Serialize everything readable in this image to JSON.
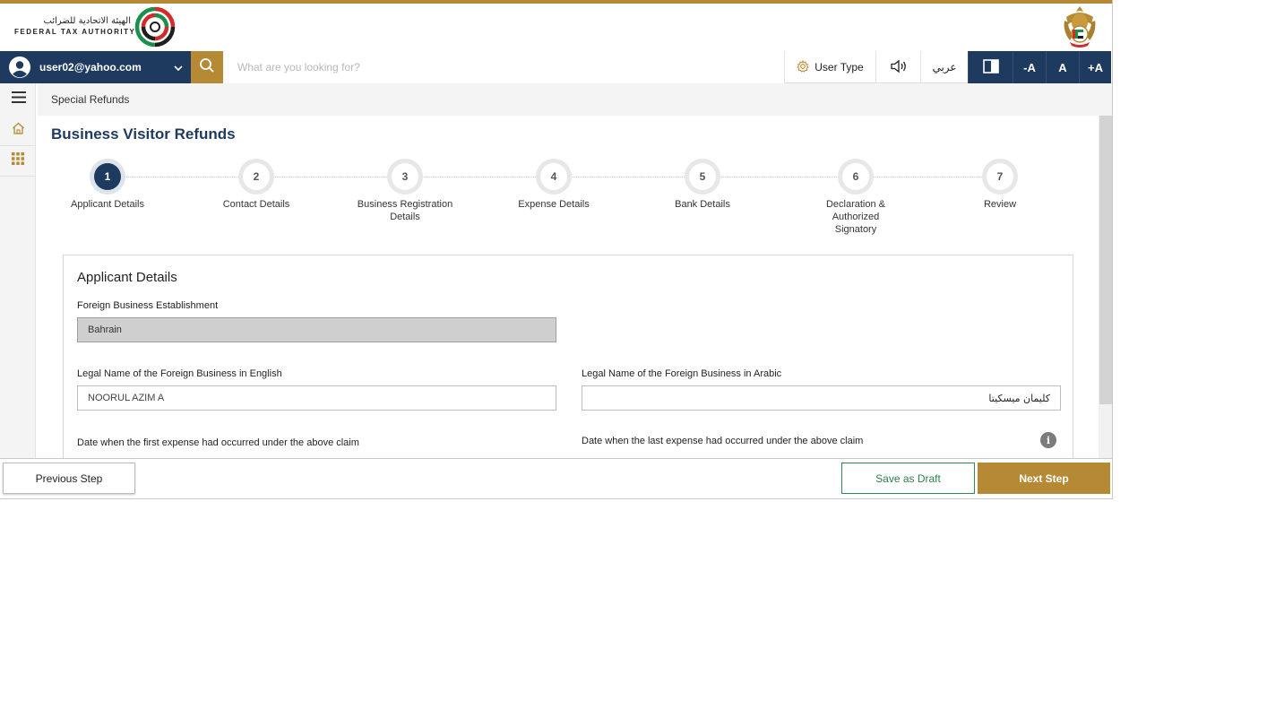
{
  "colors": {
    "brand_gold": "#b68a35",
    "navy": "#1e3a5f",
    "draft_green": "#2f8a57"
  },
  "header": {
    "logo_arabic": "الهيئة الاتحادية للضرائب",
    "logo_english": "FEDERAL TAX AUTHORITY",
    "logo_icon": "fta-logo-icon",
    "emblem_icon": "uae-emblem-icon"
  },
  "navbar": {
    "user_email": "user02@yahoo.com",
    "search_placeholder": "What are you looking for?",
    "user_type_label": "User Type",
    "language_label": "عربي",
    "font_decrease": "-A",
    "font_normal": "A",
    "font_increase": "+A"
  },
  "breadcrumb": {
    "current": "Special Refunds"
  },
  "page": {
    "title": "Business Visitor Refunds"
  },
  "stepper": {
    "active_step": 1,
    "steps": [
      {
        "number": "1",
        "label": "Applicant Details"
      },
      {
        "number": "2",
        "label": "Contact Details"
      },
      {
        "number": "3",
        "label": "Business Registration Details"
      },
      {
        "number": "4",
        "label": "Expense Details"
      },
      {
        "number": "5",
        "label": "Bank Details"
      },
      {
        "number": "6",
        "label": "Declaration & Authorized Signatory"
      },
      {
        "number": "7",
        "label": "Review"
      }
    ]
  },
  "form": {
    "section_title": "Applicant Details",
    "foreign_business": {
      "label": "Foreign Business Establishment",
      "value": "Bahrain"
    },
    "legal_name_en": {
      "label": "Legal Name of the Foreign Business in English",
      "value": "NOORUL AZIM A"
    },
    "legal_name_ar": {
      "label": "Legal Name of the Foreign Business in Arabic",
      "value": "كليمان ميسكيتا"
    },
    "first_expense_label": "Date when the first expense had occurred under the above claim",
    "last_expense_label": "Date when the last expense had occurred under the above claim",
    "info_glyph": "i"
  },
  "footer": {
    "previous": "Previous Step",
    "save_draft": "Save as Draft",
    "next": "Next Step"
  }
}
